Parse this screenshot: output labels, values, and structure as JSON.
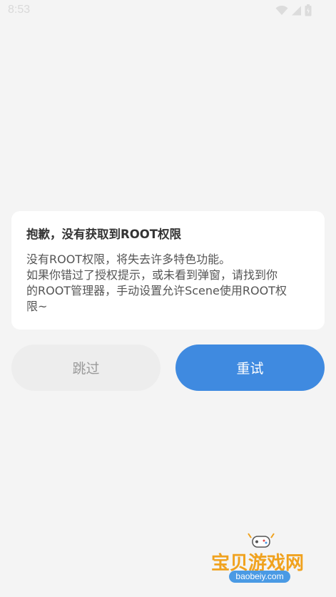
{
  "status_bar": {
    "time": "8:53",
    "icons": [
      "wifi-icon",
      "signal-icon",
      "battery-icon"
    ]
  },
  "dialog": {
    "title": "抱歉，没有获取到ROOT权限",
    "message_lines": [
      "没有ROOT权限，将失去许多特色功能。",
      "如果你错过了授权提示，或未看到弹窗，请找到你",
      "的ROOT管理器，手动设置允许Scene使用ROOT权",
      "限~"
    ]
  },
  "buttons": {
    "skip_label": "跳过",
    "retry_label": "重试"
  },
  "watermark": {
    "brand": "宝贝游戏网",
    "url": "baobeiy.com"
  },
  "colors": {
    "accent": "#3f8ae0",
    "background": "#f4f4f4",
    "card": "#ffffff",
    "watermark_orange": "#f0a21e",
    "watermark_blue": "#4a9ae4"
  }
}
